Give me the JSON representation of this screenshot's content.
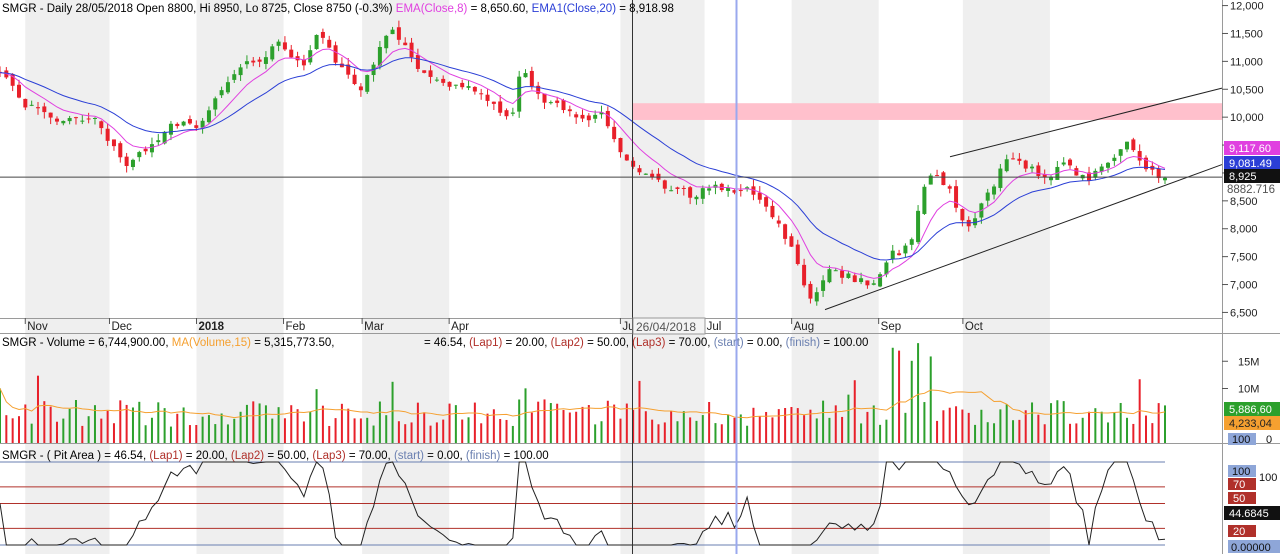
{
  "colors": {
    "up": "#2ca02c",
    "down": "#e8202a",
    "ema": "#e040e0",
    "ema1": "#2b3fd6",
    "vol_ma": "#f5a030",
    "resistance_zone": "#ffc0cc",
    "lap_line": "#b0302a",
    "limit_line": "#6a7fb0",
    "osc_line": "#222222",
    "month_shade": "#efefef",
    "crosshair_blue": "#9aa8ee"
  },
  "price_header": {
    "prefix": "SMGR - Daily 28/05/2018 Open 8800, Hi 8950, Lo 8725, Close 8750 (-0.3%)",
    "ema_label": "EMA(Close,8)",
    "ema_value": "= 8,650.60,",
    "ema1_label": "EMA1(Close,20)",
    "ema1_value": "= 8,918.98"
  },
  "volume_header": {
    "prefix": "SMGR - Volume = 6,744,900.00,",
    "ma_label": "MA(Volume,15)",
    "ma_value": "= 5,315,773.50,",
    "mid": "= 46.54,",
    "lap1_label": "(Lap1)",
    "lap1_value": "= 20.00,",
    "lap2_label": "(Lap2)",
    "lap2_value": "= 50.00,",
    "lap3_label": "(Lap3)",
    "lap3_value": "= 70.00,",
    "start_label": "(start)",
    "start_value": "= 0.00,",
    "finish_label": "(finish)",
    "finish_value": "= 100.00"
  },
  "osc_header": {
    "prefix": "SMGR - ( Pit Area  )",
    "value": "= 46.54,",
    "lap1_label": "(Lap1)",
    "lap1_value": "= 20.00,",
    "lap2_label": "(Lap2)",
    "lap2_value": "= 50.00,",
    "lap3_label": "(Lap3)",
    "lap3_value": "= 70.00,",
    "start_label": "(start)",
    "start_value": "= 0.00,",
    "finish_label": "(finish)",
    "finish_value": "= 100.00"
  },
  "date_tooltip": "26/04/2018",
  "chart_data": [
    {
      "type": "candlestick",
      "name": "SMGR",
      "x_labels": [
        "Nov",
        "Dec",
        "2018",
        "Feb",
        "Mar",
        "Apr",
        "Jun",
        "Jul",
        "Aug",
        "Sep",
        "Oct"
      ],
      "y_ticks": [
        "12,000",
        "11,500",
        "11,000",
        "10,500",
        "10,000",
        "9,500",
        "9,000",
        "8,500",
        "8,000",
        "7,500",
        "7,000",
        "6,500"
      ],
      "ylim": [
        6400,
        12100
      ],
      "close_path": [
        {
          "x": "2017-10-23",
          "y": 10800
        },
        {
          "x": "2017-11-01",
          "y": 10250
        },
        {
          "x": "2017-11-10",
          "y": 9950
        },
        {
          "x": "2017-11-17",
          "y": 9950
        },
        {
          "x": "2017-11-24",
          "y": 10050
        },
        {
          "x": "2017-12-01",
          "y": 9550
        },
        {
          "x": "2017-12-08",
          "y": 9150
        },
        {
          "x": "2017-12-15",
          "y": 9500
        },
        {
          "x": "2017-12-22",
          "y": 9800
        },
        {
          "x": "2018-01-03",
          "y": 9900
        },
        {
          "x": "2018-01-10",
          "y": 10500
        },
        {
          "x": "2018-01-17",
          "y": 10900
        },
        {
          "x": "2018-01-24",
          "y": 11000
        },
        {
          "x": "2018-01-31",
          "y": 11400
        },
        {
          "x": "2018-02-07",
          "y": 10900
        },
        {
          "x": "2018-02-14",
          "y": 11500
        },
        {
          "x": "2018-02-21",
          "y": 10900
        },
        {
          "x": "2018-02-28",
          "y": 10400
        },
        {
          "x": "2018-03-06",
          "y": 11050
        },
        {
          "x": "2018-03-12",
          "y": 11650
        },
        {
          "x": "2018-03-19",
          "y": 11000
        },
        {
          "x": "2018-03-26",
          "y": 10700
        },
        {
          "x": "2018-04-02",
          "y": 10600
        },
        {
          "x": "2018-04-09",
          "y": 10550
        },
        {
          "x": "2018-04-16",
          "y": 10300
        },
        {
          "x": "2018-04-23",
          "y": 9850
        },
        {
          "x": "2018-04-27",
          "y": 10950
        },
        {
          "x": "2018-05-04",
          "y": 10300
        },
        {
          "x": "2018-05-11",
          "y": 10200
        },
        {
          "x": "2018-05-18",
          "y": 9950
        },
        {
          "x": "2018-05-25",
          "y": 10100
        },
        {
          "x": "2018-06-01",
          "y": 9300
        },
        {
          "x": "2018-06-08",
          "y": 9000
        },
        {
          "x": "2018-06-13",
          "y": 8850
        },
        {
          "x": "2018-06-27",
          "y": 8600
        },
        {
          "x": "2018-07-04",
          "y": 8750
        },
        {
          "x": "2018-07-11",
          "y": 8650
        },
        {
          "x": "2018-07-18",
          "y": 8700
        },
        {
          "x": "2018-07-25",
          "y": 8250
        },
        {
          "x": "2018-08-01",
          "y": 7600
        },
        {
          "x": "2018-08-08",
          "y": 6750
        },
        {
          "x": "2018-08-15",
          "y": 7300
        },
        {
          "x": "2018-08-22",
          "y": 7100
        },
        {
          "x": "2018-08-29",
          "y": 7000
        },
        {
          "x": "2018-09-05",
          "y": 7500
        },
        {
          "x": "2018-09-12",
          "y": 7700
        },
        {
          "x": "2018-09-19",
          "y": 9000
        },
        {
          "x": "2018-09-26",
          "y": 8700
        },
        {
          "x": "2018-10-03",
          "y": 8000
        },
        {
          "x": "2018-10-10",
          "y": 8600
        },
        {
          "x": "2018-10-17",
          "y": 9250
        },
        {
          "x": "2018-10-24",
          "y": 9100
        },
        {
          "x": "2018-10-31",
          "y": 8900
        },
        {
          "x": "2018-11-07",
          "y": 9150
        },
        {
          "x": "2018-11-14",
          "y": 8900
        },
        {
          "x": "2018-11-21",
          "y": 9200
        },
        {
          "x": "2018-11-28",
          "y": 9550
        },
        {
          "x": "2018-12-05",
          "y": 9000
        },
        {
          "x": "2018-12-12",
          "y": 8950
        }
      ],
      "resistance_zone": [
        9950,
        10250
      ],
      "horizontal_line": 8925,
      "trendline_upper": [
        [
          7850,
          9290
        ],
        [
          9850,
          9950
        ]
      ],
      "trendline_lower": [
        [
          7150,
          6550
        ],
        [
          11900,
          8930
        ]
      ],
      "price_badges": [
        "9,117.60",
        "9,081.49",
        "8,925",
        "8882.716"
      ]
    },
    {
      "type": "bar",
      "name": "Volume",
      "y_ticks": [
        "15M",
        "10M"
      ],
      "ylim": [
        0,
        20000000
      ],
      "ma_length": 15,
      "value_badges": [
        "5,886,60",
        "4,233,04",
        "100",
        "0"
      ]
    },
    {
      "type": "line",
      "name": "Pit Area",
      "ylim": [
        0,
        100
      ],
      "levels": {
        "start": 0,
        "lap1": 20,
        "lap2": 50,
        "lap3": 70,
        "finish": 100
      },
      "value_badges": [
        "100",
        "70",
        "50",
        "44.6845",
        "20",
        "0.00000"
      ],
      "y_ticks": [
        "100"
      ]
    }
  ]
}
